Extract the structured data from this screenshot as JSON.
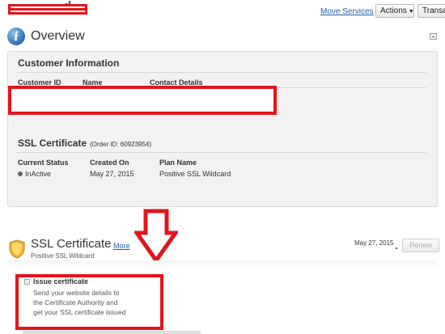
{
  "header": {
    "site_title": "d",
    "move_services_label": "Move Services",
    "actions_label": "Actions",
    "transactions_label": "Transa"
  },
  "overview": {
    "title": "Overview",
    "customer_info": {
      "heading": "Customer Information",
      "columns": [
        "Customer ID",
        "Name",
        "Contact Details"
      ]
    },
    "ssl": {
      "heading": "SSL Certificate",
      "order_id": "(Order ID: 60923954)",
      "columns": [
        "Current Status",
        "Created On",
        "Plan Name"
      ],
      "status": "InActive",
      "created_on": "May 27, 2015",
      "plan_name": "Positive SSL Wildcard"
    }
  },
  "ssl_section": {
    "title": "SSL Certificate",
    "more_label": "More",
    "subtitle": "Positive SSL Wildcard",
    "date": "May 27, 2015",
    "renew_label": "Renew",
    "issue": {
      "title": "Issue certificate",
      "desc": [
        "Send your website details to",
        "the Certificate Authority and",
        "get your SSL certificate issued"
      ]
    }
  },
  "icons": [
    "info-icon",
    "minimize-icon",
    "shield-icon",
    "down-arrow-icon",
    "checkbox-icon"
  ],
  "colors": {
    "redaction": "#e3151c",
    "link": "#1f5fa6",
    "panel_bg": "#f2f2f2",
    "shield": "#f0b232"
  }
}
